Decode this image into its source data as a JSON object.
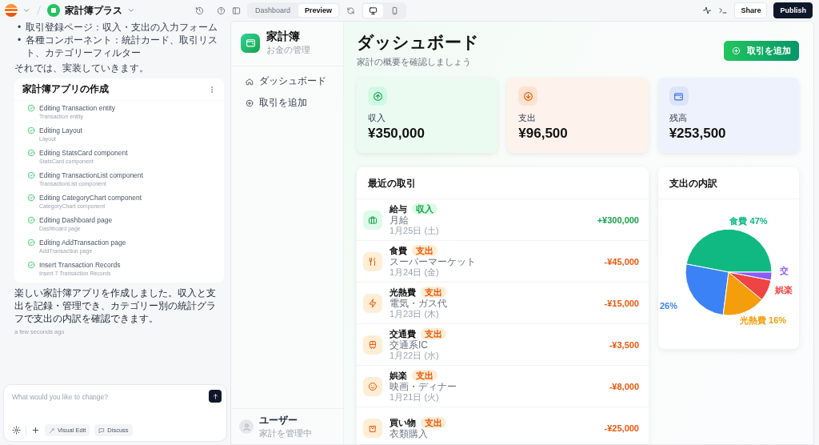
{
  "topbar": {
    "project": "家計簿プラス",
    "tabs": [
      {
        "label": "Dashboard",
        "selected": false
      },
      {
        "label": "Preview",
        "selected": true
      }
    ],
    "devices": [
      {
        "kind": "desktop",
        "selected": true
      },
      {
        "kind": "mobile",
        "selected": false
      }
    ],
    "buttons": [
      {
        "label": "Share",
        "kind": "secondary"
      },
      {
        "label": "Publish",
        "kind": "primary"
      }
    ]
  },
  "chat": {
    "bullets": [
      {
        "marker": "•",
        "text": "取引登録ページ：収入・支出の入力フォーム"
      },
      {
        "marker": "•",
        "text": "各種コンポーネント：統計カード、取引リスト、カテゴリーフィルター"
      }
    ],
    "intro": "それでは、実装していきます。",
    "task_card": {
      "title": "家計簿アプリの作成",
      "steps": [
        {
          "title": "Editing Transaction entity",
          "subtitle": "Transaction entity",
          "done": true
        },
        {
          "title": "Editing Layout",
          "subtitle": "Layout",
          "done": true
        },
        {
          "title": "Editing StatsCard component",
          "subtitle": "StatsCard component",
          "done": true
        },
        {
          "title": "Editing TransactionList component",
          "subtitle": "TransactionList component",
          "done": true
        },
        {
          "title": "Editing CategoryChart component",
          "subtitle": "CategoryChart component",
          "done": true
        },
        {
          "title": "Editing Dashboard page",
          "subtitle": "Dashboard page",
          "done": true
        },
        {
          "title": "Editing AddTransaction page",
          "subtitle": "AddTransaction page",
          "done": true
        },
        {
          "title": "Insert Transaction Records",
          "subtitle": "Insert 7 Transaction Records",
          "done": true
        }
      ]
    },
    "message": "楽しい家計簿アプリを作成しました。収入と支出を記録・管理でき、カテゴリー別の統計グラフで支出の内訳を確認できます。",
    "time": "a few seconds ago",
    "composer": {
      "placeholder": "What would you like to change?",
      "tools": [
        "Visual Edit",
        "Discuss"
      ]
    }
  },
  "app": {
    "sidebar": {
      "brand": "家計簿",
      "tagline": "お金の管理",
      "nav": [
        {
          "label": "ダッシュボード",
          "selected": false
        },
        {
          "label": "取引を追加",
          "selected": false
        }
      ],
      "user": {
        "name": "ユーザー",
        "caption": "家計を管理中"
      }
    },
    "header": {
      "title": "ダッシュボード",
      "subtitle": "家計の概要を確認しましょう",
      "action": "取引を追加"
    },
    "stats": [
      {
        "label": "収入",
        "value": "¥350,000",
        "kind": "income"
      },
      {
        "label": "支出",
        "value": "¥96,500",
        "kind": "expense"
      },
      {
        "label": "残高",
        "value": "¥253,500",
        "kind": "balance"
      }
    ],
    "transactions": {
      "title": "最近の取引",
      "rows": [
        {
          "category": "給与",
          "badge": "収入",
          "kind": "income",
          "description": "月給",
          "date": "1月25日 (土)",
          "amount": "+¥300,000"
        },
        {
          "category": "食費",
          "badge": "支出",
          "kind": "expense",
          "description": "スーパーマーケット",
          "date": "1月24日 (金)",
          "amount": "-¥45,000"
        },
        {
          "category": "光熱費",
          "badge": "支出",
          "kind": "expense",
          "description": "電気・ガス代",
          "date": "1月23日 (木)",
          "amount": "-¥15,000"
        },
        {
          "category": "交通費",
          "badge": "支出",
          "kind": "expense",
          "description": "交通系IC",
          "date": "1月22日 (水)",
          "amount": "-¥3,500"
        },
        {
          "category": "娯楽",
          "badge": "支出",
          "kind": "expense",
          "description": "映画・ディナー",
          "date": "1月21日 (火)",
          "amount": "-¥8,000"
        },
        {
          "category": "買い物",
          "badge": "支出",
          "kind": "expense",
          "description": "衣類購入",
          "amount": "-¥25,000"
        }
      ]
    },
    "breakdown": {
      "title": "支出の内訳",
      "chart_data": {
        "type": "pie",
        "values": [
          47,
          26,
          16,
          8,
          3
        ]
      },
      "slices": [
        {
          "color": "#10b981"
        },
        {
          "color": "#3b82f6"
        },
        {
          "color": "#f59e0b"
        },
        {
          "color": "#ef4444"
        },
        {
          "color": "#8b5cf6"
        }
      ],
      "slice_labels": [
        {
          "text": "食費 47%",
          "color": "#10b981"
        },
        {
          "text": "交",
          "color": "#8b5cf6"
        },
        {
          "text": "娯楽",
          "color": "#ef4444"
        },
        {
          "text": "26%",
          "color": "#3b82f6"
        },
        {
          "text": "光熱費 16%",
          "color": "#f59e0b"
        }
      ]
    }
  }
}
